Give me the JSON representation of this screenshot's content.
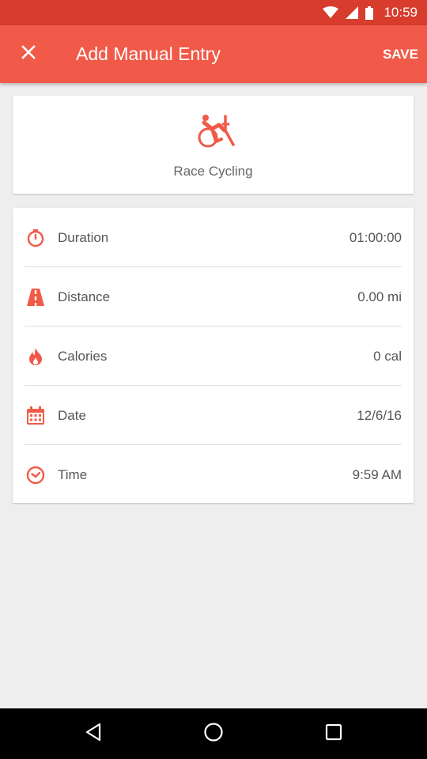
{
  "status_bar": {
    "time": "10:59"
  },
  "header": {
    "title": "Add Manual Entry",
    "save_label": "SAVE"
  },
  "activity": {
    "name": "Race Cycling",
    "icon": "race-cycling-icon"
  },
  "fields": [
    {
      "key": "duration",
      "label": "Duration",
      "value": "01:00:00",
      "icon": "stopwatch-icon"
    },
    {
      "key": "distance",
      "label": "Distance",
      "value": "0.00 mi",
      "icon": "road-icon"
    },
    {
      "key": "calories",
      "label": "Calories",
      "value": "0 cal",
      "icon": "flame-icon"
    },
    {
      "key": "date",
      "label": "Date",
      "value": "12/6/16",
      "icon": "calendar-icon"
    },
    {
      "key": "time",
      "label": "Time",
      "value": "9:59 AM",
      "icon": "clock-icon"
    }
  ],
  "colors": {
    "accent": "#f15a48",
    "status_bar": "#d83c2c",
    "background": "#eeeeee"
  }
}
